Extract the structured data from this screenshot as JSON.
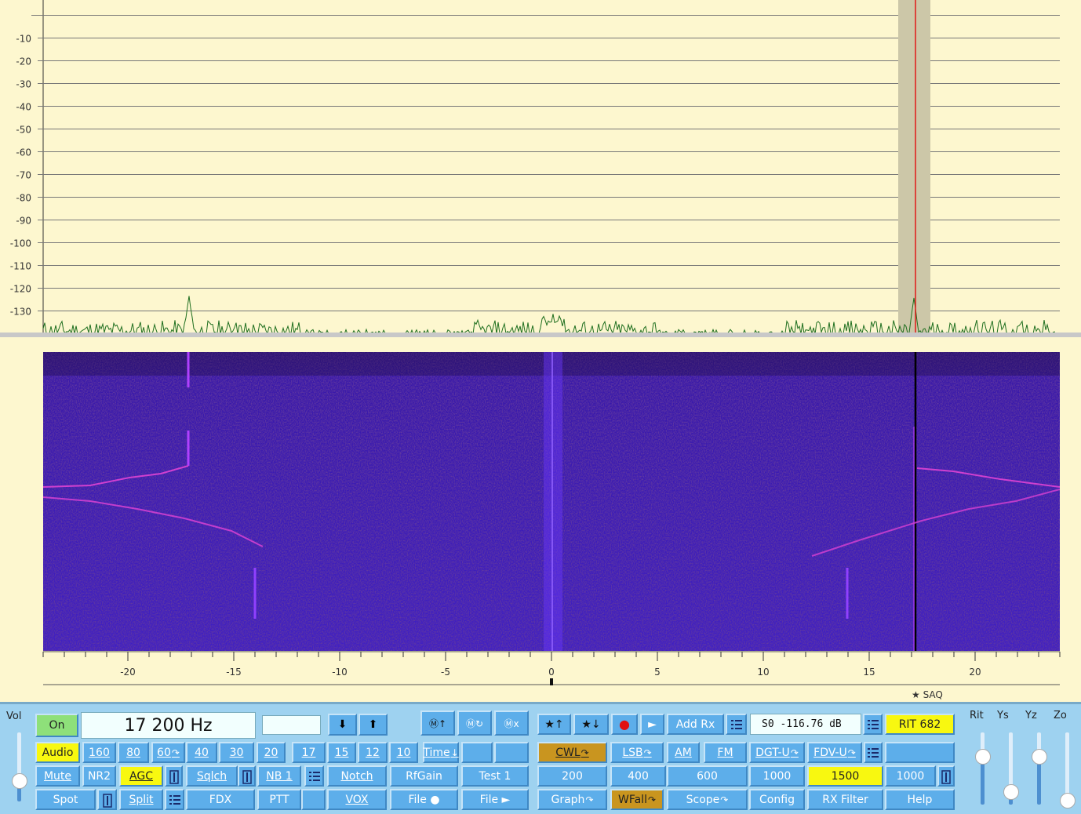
{
  "spectrum": {
    "y_ticks": [
      "-10",
      "-20",
      "-30",
      "-40",
      "-50",
      "-60",
      "-70",
      "-80",
      "-90",
      "-100",
      "-110",
      "-120",
      "-130"
    ],
    "trace_color": "#1e6e1e",
    "marker_color": "#e01818"
  },
  "scale": {
    "x_ticks": [
      "-20",
      "-15",
      "-10",
      "-5",
      "0",
      "5",
      "10",
      "15",
      "20"
    ],
    "station_label": "★ SAQ"
  },
  "left": {
    "vol_label": "Vol",
    "on_label": "On",
    "frequency": "17 200 Hz",
    "aux_field": "",
    "row2": [
      "Audio",
      "160",
      "80",
      "60",
      "40",
      "30",
      "20",
      "17",
      "15",
      "12",
      "10",
      "Time"
    ],
    "row3": [
      "Mute",
      "NR2",
      "AGC",
      "Sqlch",
      "NB 1",
      "Notch",
      "RfGain",
      "Test 1"
    ],
    "row4": [
      "Spot",
      "Split",
      "FDX",
      "PTT",
      "VOX",
      "File ●",
      "File ►"
    ]
  },
  "right": {
    "star_up": "★↑",
    "star_down": "★↓",
    "record_icon": "●",
    "play_icon": "►",
    "add_rx": "Add Rx",
    "meter": "S0  -116.76 dB",
    "rit": "RIT 682",
    "modes": [
      "CWL",
      "LSB",
      "AM",
      "FM",
      "DGT-U",
      "FDV-U"
    ],
    "filters": [
      "200",
      "400",
      "600",
      "1000",
      "1500",
      "1000"
    ],
    "row4": [
      "Graph",
      "WFall",
      "Scope",
      "Config",
      "RX Filter",
      "Help"
    ]
  },
  "sliders": {
    "labels": [
      "Rit",
      "Ys",
      "Yz",
      "Zo"
    ]
  },
  "memory": {
    "m_up": "Ⓜ↑",
    "m_recall": "Ⓜ↻",
    "m_clear": "Ⓜx"
  }
}
